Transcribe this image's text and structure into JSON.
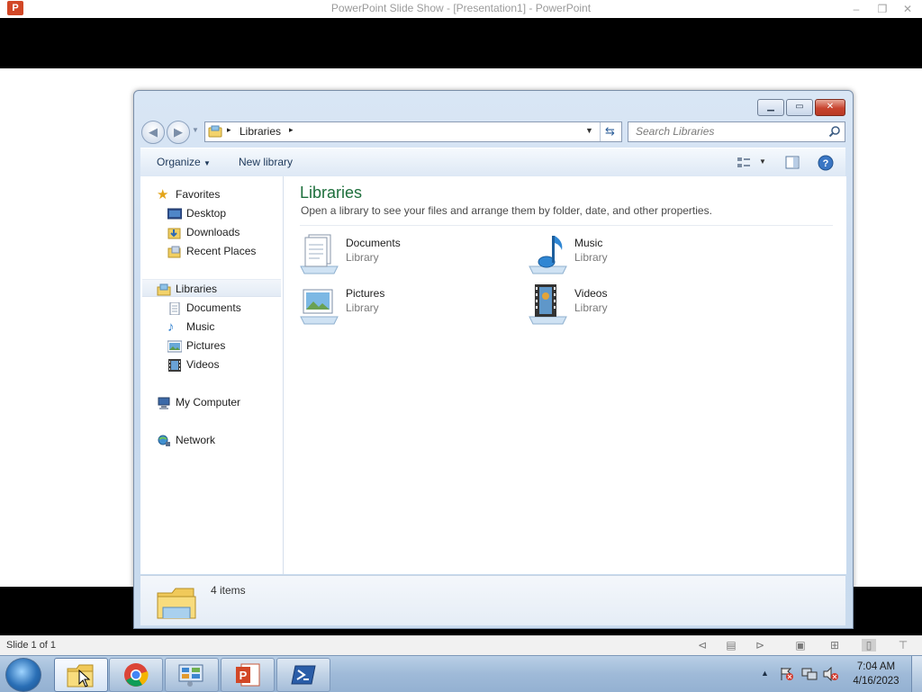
{
  "ppt": {
    "title": "PowerPoint Slide Show - [Presentation1] - PowerPoint",
    "logo_letter": "P",
    "status_text": "Slide 1 of 1"
  },
  "explorer": {
    "address": {
      "breadcrumb": "Libraries",
      "arrow": "▸"
    },
    "search": {
      "placeholder": "Search Libraries"
    },
    "toolbar": {
      "organize_label": "Organize",
      "new_library_label": "New library"
    },
    "nav": {
      "favorites": {
        "label": "Favorites",
        "items": [
          "Desktop",
          "Downloads",
          "Recent Places"
        ]
      },
      "libraries": {
        "label": "Libraries",
        "items": [
          "Documents",
          "Music",
          "Pictures",
          "Videos"
        ]
      },
      "computer_label": "My Computer",
      "network_label": "Network"
    },
    "content": {
      "title": "Libraries",
      "subtitle": "Open a library to see your files and arrange them by folder, date, and other properties.",
      "items": [
        {
          "name": "Documents",
          "type": "Library",
          "icon": "documents-library-icon"
        },
        {
          "name": "Music",
          "type": "Library",
          "icon": "music-library-icon"
        },
        {
          "name": "Pictures",
          "type": "Library",
          "icon": "pictures-library-icon"
        },
        {
          "name": "Videos",
          "type": "Library",
          "icon": "videos-library-icon"
        }
      ]
    },
    "status": {
      "item_count": "4 items"
    }
  },
  "taskbar": {
    "time": "7:04 AM",
    "date": "4/16/2023"
  },
  "colors": {
    "title_green": "#1e6f3c",
    "ppt_red": "#d24726",
    "taskbar_blue": "#9fbad8"
  }
}
